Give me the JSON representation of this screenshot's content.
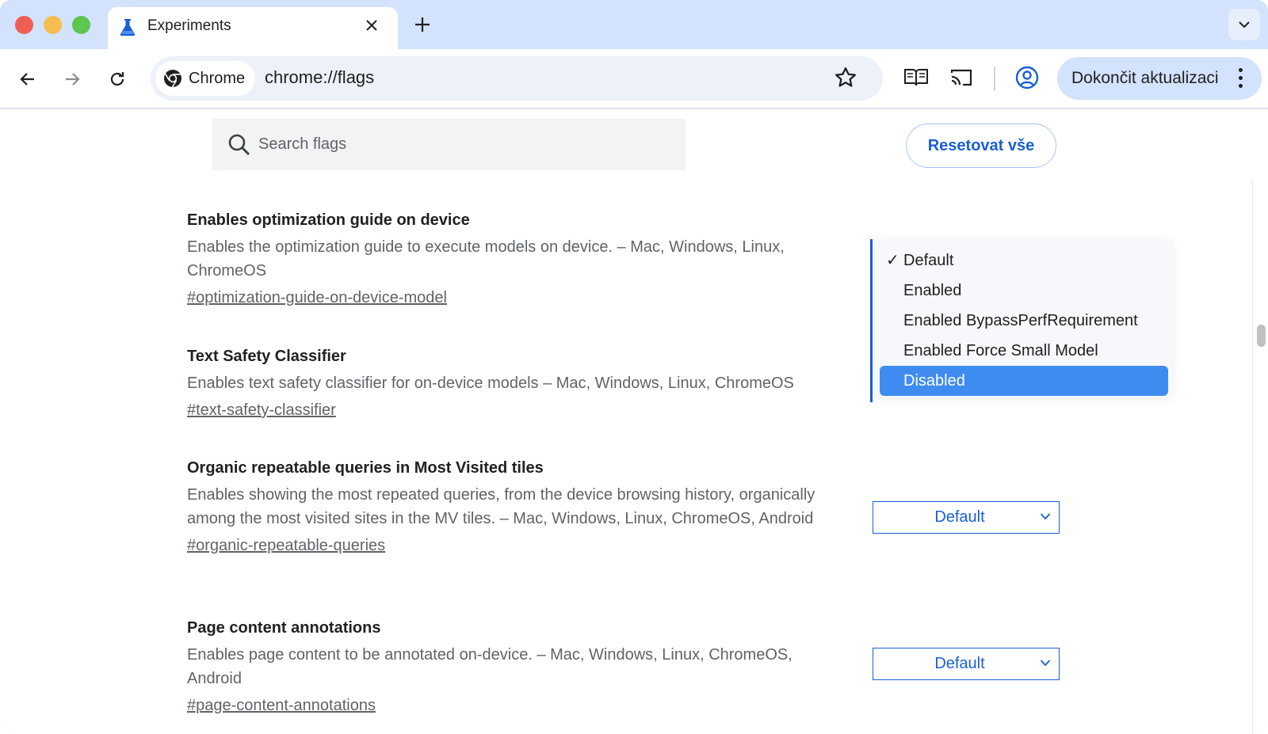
{
  "tab": {
    "title": "Experiments"
  },
  "toolbar": {
    "chip_label": "Chrome",
    "url": "chrome://flags",
    "update_label": "Dokončit aktualizaci"
  },
  "flags_header": {
    "search_placeholder": "Search flags",
    "reset_label": "Resetovat vše"
  },
  "flags": [
    {
      "title": "Enables optimization guide on device",
      "description": "Enables the optimization guide to execute models on device. – Mac, Windows, Linux, ChromeOS",
      "link": "#optimization-guide-on-device-model"
    },
    {
      "title": "Text Safety Classifier",
      "description": "Enables text safety classifier for on-device models – Mac, Windows, Linux, ChromeOS",
      "link": "#text-safety-classifier"
    },
    {
      "title": "Organic repeatable queries in Most Visited tiles",
      "description": "Enables showing the most repeated queries, from the device browsing history, organically among the most visited sites in the MV tiles. – Mac, Windows, Linux, ChromeOS, Android",
      "link": "#organic-repeatable-queries",
      "select_value": "Default"
    },
    {
      "title": "Page content annotations",
      "description": "Enables page content to be annotated on-device. – Mac, Windows, Linux, ChromeOS, Android",
      "link": "#page-content-annotations",
      "select_value": "Default"
    }
  ],
  "dropdown": {
    "checked_mark": "✓",
    "options": [
      "Default",
      "Enabled",
      "Enabled BypassPerfRequirement",
      "Enabled Force Small Model",
      "Disabled"
    ],
    "checked_index": 0,
    "highlighted_index": 4
  },
  "colors": {
    "accent": "#1a5fd8",
    "tabstrip": "#d3e3fd",
    "highlight": "#3f8cf0"
  }
}
